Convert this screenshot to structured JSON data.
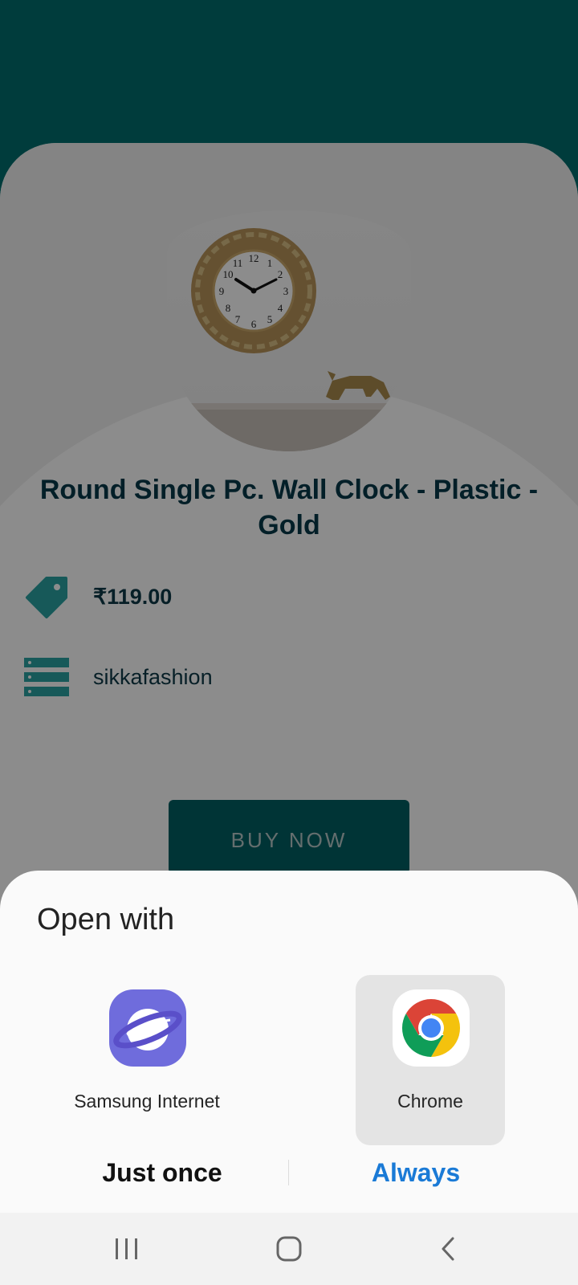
{
  "product": {
    "title": "Round Single Pc. Wall Clock - Plastic - Gold",
    "price": "₹119.00",
    "seller": "sikkafashion",
    "buy_label": "BUY NOW"
  },
  "icons": {
    "price": "price-tag-icon",
    "seller": "seller-list-icon"
  },
  "colors": {
    "header": "#006e6e",
    "title": "#06394a",
    "accent_icon": "#2aa3a3",
    "button": "#005f63",
    "always_link": "#1a7ad6"
  },
  "dialog": {
    "title": "Open with",
    "apps": [
      {
        "label": "Samsung Internet",
        "icon": "samsung-internet-icon",
        "selected": false
      },
      {
        "label": "Chrome",
        "icon": "chrome-icon",
        "selected": true
      }
    ],
    "just_once": "Just once",
    "always": "Always"
  },
  "navbar": {
    "recent": "recent-apps-icon",
    "home": "home-icon",
    "back": "back-icon"
  }
}
